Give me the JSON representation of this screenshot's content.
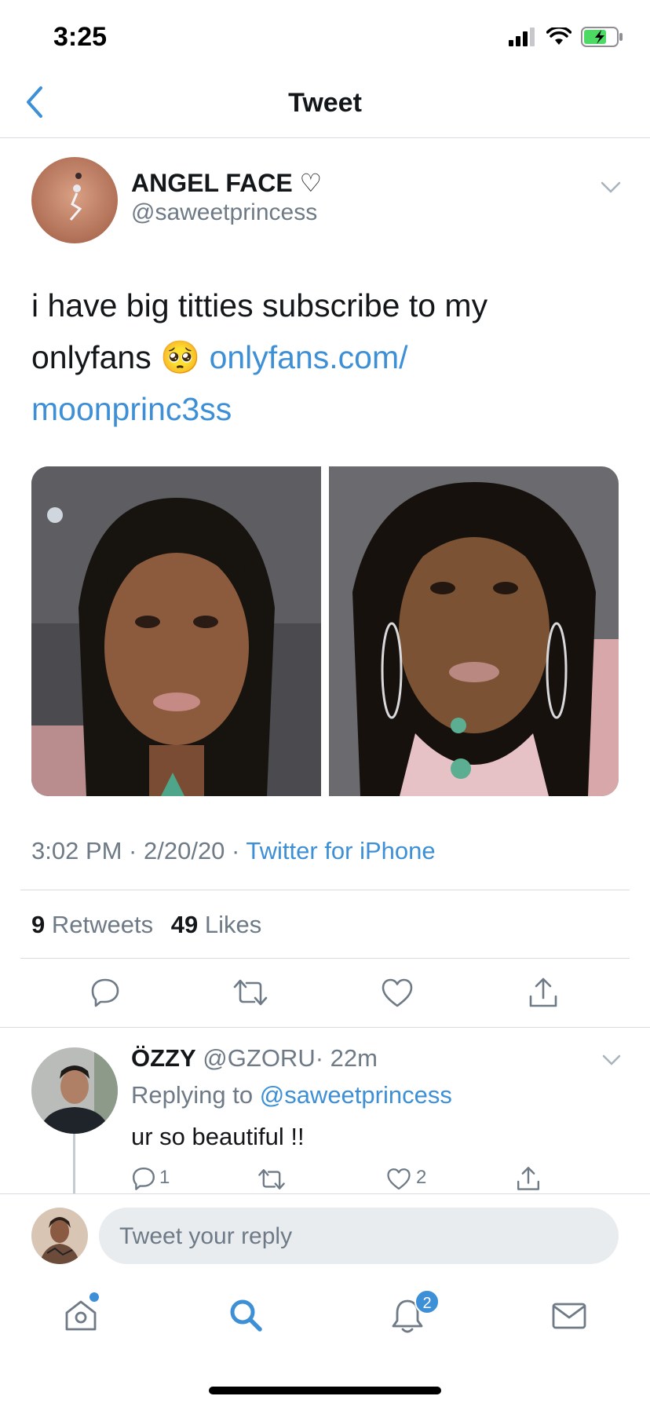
{
  "status_bar": {
    "time": "3:25"
  },
  "header": {
    "title": "Tweet"
  },
  "tweet": {
    "display_name": "ANGEL FACE ♡",
    "handle": "@saweetprincess",
    "text_line1": "i have big titties subscribe to my",
    "text_line2": "onlyfans 🥺",
    "link_part1": "onlyfans.com/",
    "link_part2": "moonprinc3ss",
    "timestamp": "3:02 PM · 2/20/20 · ",
    "source": "Twitter for iPhone",
    "retweets_count": "9",
    "retweets_label": "Retweets",
    "likes_count": "49",
    "likes_label": "Likes"
  },
  "reply": {
    "display_name": "ÖZZY",
    "handle": "@GZORU",
    "time": "· 22m",
    "replying_prefix": "Replying to",
    "replying_handle": "@saweetprincess",
    "text": "ur so beautiful !!",
    "reply_count": "1",
    "like_count": "2"
  },
  "compose": {
    "placeholder": "Tweet your reply"
  },
  "tabbar": {
    "notifications_badge": "2"
  },
  "colors": {
    "accent": "#3d8fd6",
    "text": "#14171a",
    "secondary": "#6e7a86",
    "divider": "#d9dde1"
  }
}
